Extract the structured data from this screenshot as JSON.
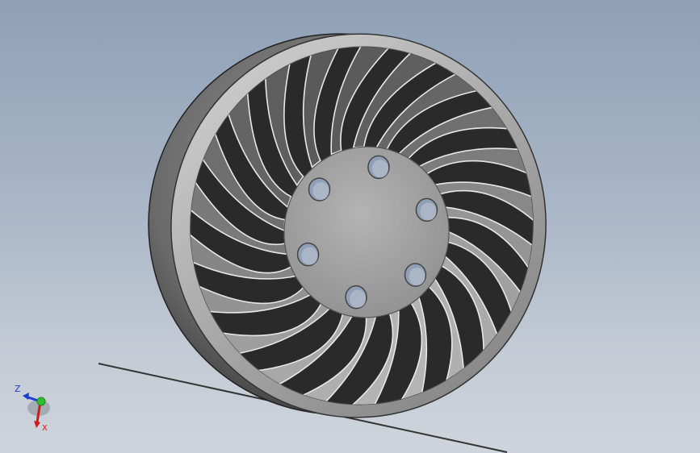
{
  "viewport": {
    "background_top": "#8fa0b6",
    "background_bottom": "#cfd4dc"
  },
  "model": {
    "part": "fan-wheel",
    "blade_count": 22,
    "hub_hole_count": 6
  },
  "triad": {
    "z_label": "Z",
    "x_label": "X",
    "z_color": "#1a3fd0",
    "x_color": "#d01a1a",
    "y_color": "#2fbf2f"
  }
}
